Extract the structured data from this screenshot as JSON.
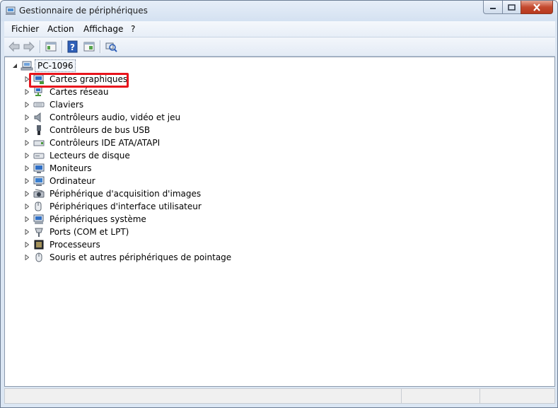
{
  "window": {
    "title": "Gestionnaire de périphériques",
    "accent_close": "#c44a2f",
    "highlight_color": "#e8141c"
  },
  "menu": {
    "items": [
      "Fichier",
      "Action",
      "Affichage",
      "?"
    ]
  },
  "toolbar": {
    "icons": [
      "back-arrow-icon",
      "forward-arrow-icon",
      "console-tree-icon",
      "help-icon",
      "properties-icon",
      "scan-hardware-icon"
    ]
  },
  "tree": {
    "root": {
      "label": "PC-1096",
      "expanded": true,
      "icon": "computer-icon"
    },
    "items": [
      {
        "label": "Cartes graphiques",
        "icon": "display-adapter-icon",
        "highlighted": true
      },
      {
        "label": "Cartes réseau",
        "icon": "network-adapter-icon"
      },
      {
        "label": "Claviers",
        "icon": "keyboard-icon"
      },
      {
        "label": "Contrôleurs audio, vidéo et jeu",
        "icon": "speaker-icon"
      },
      {
        "label": "Contrôleurs de bus USB",
        "icon": "usb-icon"
      },
      {
        "label": "Contrôleurs IDE ATA/ATAPI",
        "icon": "ide-controller-icon"
      },
      {
        "label": "Lecteurs de disque",
        "icon": "disk-drive-icon"
      },
      {
        "label": "Moniteurs",
        "icon": "monitor-icon"
      },
      {
        "label": "Ordinateur",
        "icon": "computer-monitor-icon"
      },
      {
        "label": "Périphérique d'acquisition d'images",
        "icon": "camera-icon"
      },
      {
        "label": "Périphériques d'interface utilisateur",
        "icon": "hid-icon"
      },
      {
        "label": "Périphériques système",
        "icon": "system-device-icon"
      },
      {
        "label": "Ports (COM et LPT)",
        "icon": "port-icon"
      },
      {
        "label": "Processeurs",
        "icon": "processor-icon"
      },
      {
        "label": "Souris et autres périphériques de pointage",
        "icon": "mouse-icon"
      }
    ]
  }
}
